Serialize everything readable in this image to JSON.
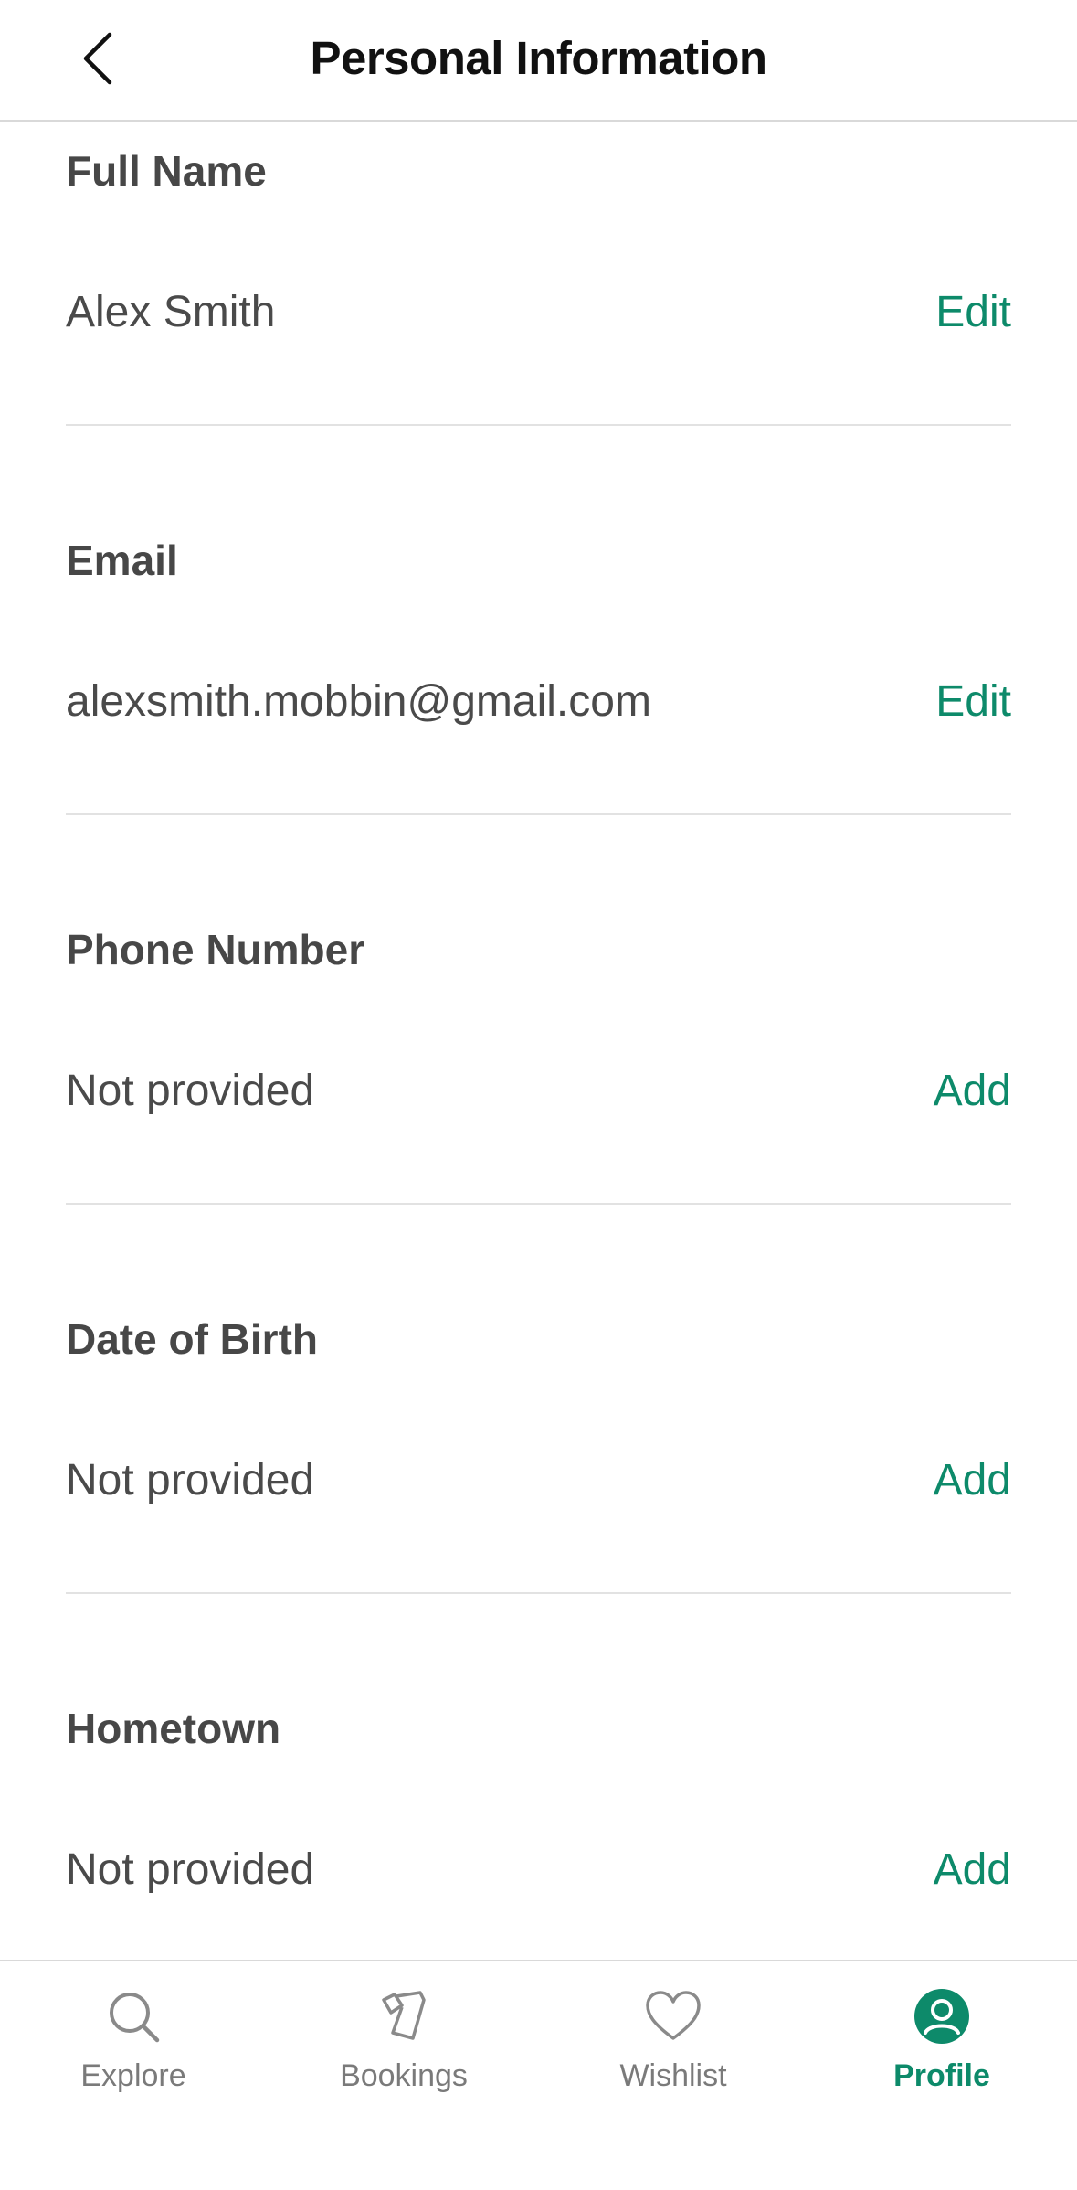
{
  "header": {
    "title": "Personal Information"
  },
  "sections": [
    {
      "label": "Full Name",
      "value": "Alex Smith",
      "action": "Edit"
    },
    {
      "label": "Email",
      "value": "alexsmith.mobbin@gmail.com",
      "action": "Edit"
    },
    {
      "label": "Phone Number",
      "value": "Not provided",
      "action": "Add"
    },
    {
      "label": "Date of Birth",
      "value": "Not provided",
      "action": "Add"
    },
    {
      "label": "Hometown",
      "value": "Not provided",
      "action": "Add"
    }
  ],
  "tabbar": {
    "tabs": [
      {
        "label": "Explore",
        "icon": "search-icon"
      },
      {
        "label": "Bookings",
        "icon": "tickets-icon"
      },
      {
        "label": "Wishlist",
        "icon": "heart-icon"
      },
      {
        "label": "Profile",
        "icon": "profile-icon",
        "active": true
      }
    ]
  },
  "colors": {
    "accent": "#0d8a6a",
    "text": "#4a4a4a",
    "title": "#111111",
    "divider": "#e2e2e2",
    "inactive_tab": "#7a7a7a"
  }
}
